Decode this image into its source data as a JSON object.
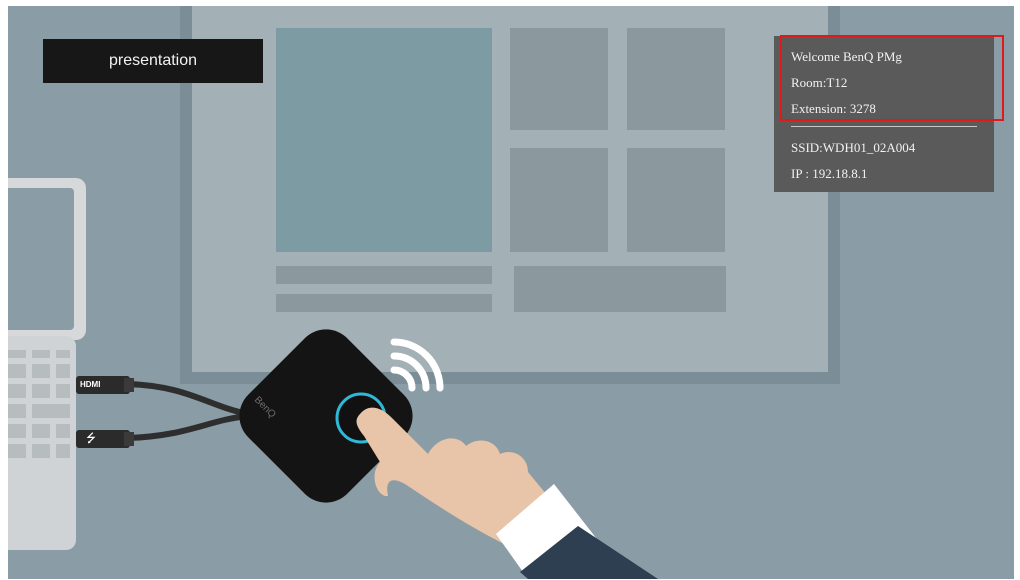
{
  "label_box": {
    "text": "presentation"
  },
  "info_panel": {
    "welcome": "Welcome BenQ PMg",
    "room": "Room:T12",
    "extension": "Extension: 3278",
    "ssid": "SSID:WDH01_02A004",
    "ip": "IP : 192.18.8.1"
  },
  "device": {
    "brand": "BenQ"
  },
  "ports": {
    "hdmi": "HDMI"
  },
  "icons": {
    "usb": "usb-icon",
    "wifi": "wifi-signal-icon",
    "hand": "hand-icon",
    "laptop": "laptop-icon",
    "button": "power-button-icon"
  },
  "colors": {
    "background": "#8a9ca5",
    "screen": "#a3b0b6",
    "dongle": "#141414",
    "button_ring": "#2fb8d8",
    "highlight": "#e0191b",
    "panel": "#5a5a5a"
  }
}
